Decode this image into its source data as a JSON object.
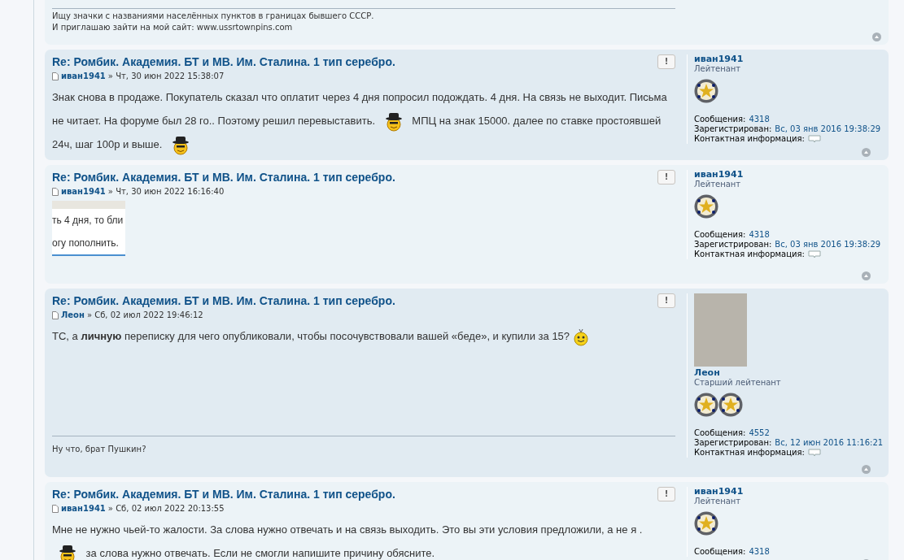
{
  "top_post": {
    "signature": [
      {
        "text": "Ищу значки с названиями населённых пунктов в границах бывшего СССР."
      },
      {
        "text": "И приглашаю зайти на мой сайт: ",
        "link": "www.ussrtownpins.com"
      }
    ]
  },
  "posts": [
    {
      "title": "Re: Ромбик. Академия. БТ и МВ. Им. Сталина. 1 тип серебро.",
      "report": "!",
      "author": "иван1941",
      "date": "» Чт, 30 июн 2022 15:38:07",
      "content": [
        {
          "kind": "text",
          "text": "Знак снова в продаже. Покупатель сказал что оплатит через 4 дня попросил подождать. 4 дня. На связь не выходит. Письма не читает. На форуме был 28 го.. Поэтому решил перевыставить. "
        },
        {
          "kind": "smiley_hat"
        },
        {
          "kind": "text",
          "text": " МПЦ на знак 15000. далее по ставке простоявшей 24ч, шаг 100р и выше. "
        },
        {
          "kind": "smiley_hat"
        }
      ],
      "profile": {
        "name": "иван1941",
        "rank": "Лейтенант",
        "rank_icons": [
          {
            "kind": "emblem"
          }
        ],
        "stats": [
          {
            "label": "Сообщения:",
            "value": "4318"
          },
          {
            "label": "Зарегистрирован:",
            "value": "Вс, 03 янв 2016 19:38:29"
          },
          {
            "label": "Контактная информация:",
            "kind": "contact"
          }
        ]
      }
    },
    {
      "title": "Re: Ромбик. Академия. БТ и МВ. Им. Сталина. 1 тип серебро.",
      "report": "!",
      "author": "иван1941",
      "date": "» Чт, 30 июн 2022 16:16:40",
      "content": [
        {
          "kind": "image",
          "lines": [
            "ть 4 дня, то бли",
            "огу пополнить."
          ]
        }
      ],
      "profile": {
        "name": "иван1941",
        "rank": "Лейтенант",
        "rank_icons": [
          {
            "kind": "emblem"
          }
        ],
        "stats": [
          {
            "label": "Сообщения:",
            "value": "4318"
          },
          {
            "label": "Зарегистрирован:",
            "value": "Вс, 03 янв 2016 19:38:29"
          },
          {
            "label": "Контактная информация:",
            "kind": "contact"
          }
        ]
      }
    },
    {
      "title": "Re: Ромбик. Академия. БТ и МВ. Им. Сталина. 1 тип серебро.",
      "report": "!",
      "author": "Леон",
      "date": "» Сб, 02 июл 2022 19:46:12",
      "content": [
        {
          "kind": "text",
          "text": "ТС, а **личную** переписку для чего опубликовали, чтобы посочувствовали вашей «беде», и купили за 15? "
        },
        {
          "kind": "smiley"
        }
      ],
      "signature": "Ну что, брат Пушкин?",
      "profile": {
        "avatar": {
          "kind": "photo"
        },
        "name": "Леон",
        "rank": "Старший лейтенант",
        "rank_icons": [
          {
            "kind": "emblem"
          },
          {
            "kind": "emblem"
          }
        ],
        "stats": [
          {
            "label": "Сообщения:",
            "value": "4552"
          },
          {
            "label": "Зарегистрирован:",
            "value": "Вс, 12 июн 2016 11:16:21"
          },
          {
            "label": "Контактная информация:",
            "kind": "contact"
          }
        ]
      }
    },
    {
      "title": "Re: Ромбик. Академия. БТ и МВ. Им. Сталина. 1 тип серебро.",
      "report": "!",
      "author": "иван1941",
      "date": "» Сб, 02 июл 2022 20:13:55",
      "content": [
        {
          "kind": "text",
          "text": "Мне не нужно чьей-то жалости. За слова нужно отвечать и на связь выходить. Это вы эти условия предложили, а не я . "
        },
        {
          "kind": "smiley_hat"
        },
        {
          "kind": "text",
          "text": " за слова нужно отвечать. Если не смогли напишите причину обясните."
        }
      ],
      "profile": {
        "name": "иван1941",
        "rank": "Лейтенант",
        "rank_icons": [
          {
            "kind": "emblem"
          }
        ],
        "stats": [
          {
            "label": "Сообщения:",
            "value": "4318"
          }
        ]
      }
    }
  ]
}
